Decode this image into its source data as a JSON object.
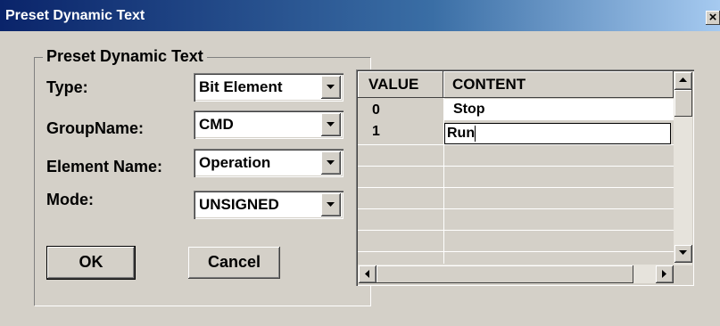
{
  "window": {
    "title": "Preset Dynamic Text",
    "close_glyph": "×"
  },
  "group": {
    "label": "Preset Dynamic Text"
  },
  "fields": {
    "type": {
      "label": "Type:",
      "value": "Bit Element"
    },
    "group_name": {
      "label": "GroupName:",
      "value": "CMD"
    },
    "element_name": {
      "label": "Element Name:",
      "value": "Operation"
    },
    "mode": {
      "label": "Mode:",
      "value": "UNSIGNED"
    }
  },
  "buttons": {
    "ok": "OK",
    "cancel": "Cancel"
  },
  "table": {
    "headers": [
      "VALUE",
      "CONTENT"
    ],
    "rows": [
      {
        "value": "0",
        "content": "Stop"
      },
      {
        "value": "1",
        "content": "Run"
      }
    ]
  },
  "icons": [
    "close-icon",
    "dropdown-arrow-icon",
    "scroll-up-icon",
    "scroll-down-icon",
    "scroll-left-icon",
    "scroll-right-icon"
  ],
  "colors": {
    "title_bar_start": "#0a246a",
    "title_bar_end": "#a6caf0",
    "dialog_face": "#d4d0c8"
  }
}
